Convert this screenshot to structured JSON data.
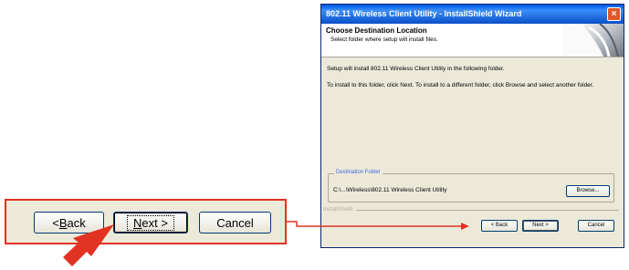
{
  "callout": {
    "back_prefix": "< ",
    "back_key": "B",
    "back_rest": "ack",
    "next_key": "N",
    "next_rest": "ext >",
    "cancel": "Cancel"
  },
  "wizard": {
    "title": "802.11 Wireless Client Utility - InstallShield Wizard",
    "close_glyph": "×",
    "header_title": "Choose Destination Location",
    "header_subtitle": "Select folder where setup will install files.",
    "body_line1": "Setup will install 802.11 Wireless Client Utility in the following folder.",
    "body_line2": "To install to this folder, click Next. To install to a different folder, click Browse and select another folder.",
    "group_label": "Destination Folder",
    "dest_path": "C:\\...\\Wireless\\802.11 Wireless Client Utility",
    "browse": "Browse...",
    "installshield": "InstallShield",
    "back": "< Back",
    "next": "Next >",
    "cancel": "Cancel"
  },
  "colors": {
    "callout_border": "#e23222",
    "arrow": "#e23222",
    "titlebar": "#0058e6",
    "dialog_bg": "#ece9d8"
  }
}
